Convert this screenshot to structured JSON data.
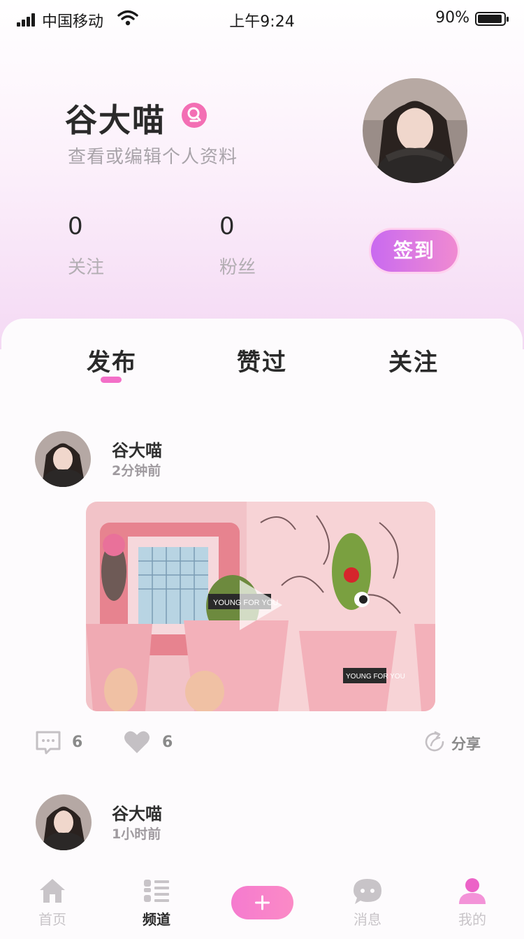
{
  "status_bar": {
    "carrier": "中国移动",
    "time": "上午9:24",
    "battery": "90%"
  },
  "profile": {
    "name": "谷大喵",
    "edit_link": "查看或编辑个人资料",
    "stats": [
      {
        "value": "0",
        "label": "关注"
      },
      {
        "value": "0",
        "label": "粉丝"
      }
    ],
    "checkin_label": "签到"
  },
  "tabs": [
    {
      "label": "发布",
      "active": true
    },
    {
      "label": "赞过",
      "active": false
    },
    {
      "label": "关注",
      "active": false
    }
  ],
  "posts": [
    {
      "author": "谷大喵",
      "time": "2分钟前",
      "comments": "6",
      "likes": "6",
      "share_label": "分享"
    },
    {
      "author": "谷大喵",
      "time": "1小时前"
    }
  ],
  "bottom_nav": [
    {
      "label": "首页",
      "icon": "home-icon"
    },
    {
      "label": "频道",
      "icon": "channel-list-icon"
    },
    {
      "label": "",
      "icon": "add-icon"
    },
    {
      "label": "消息",
      "icon": "message-icon"
    },
    {
      "label": "我的",
      "icon": "profile-icon"
    }
  ],
  "colors": {
    "accent_pink": "#f36fc8",
    "checkin_gradient_start": "#c96af0",
    "checkin_gradient_end": "#f08ad1"
  }
}
